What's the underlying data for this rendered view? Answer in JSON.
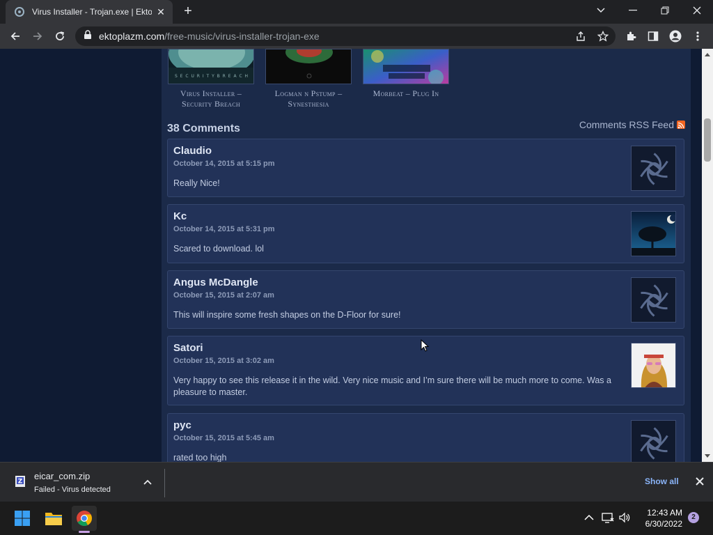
{
  "browser": {
    "tab_title": "Virus Installer - Trojan.exe | Ektoplazm",
    "url_host": "ektoplazm.com",
    "url_path": "/free-music/virus-installer-trojan-exe"
  },
  "related": [
    {
      "caption": "Virus Installer – Security Breach"
    },
    {
      "caption": "Logman n Pstump – Synesthesia"
    },
    {
      "caption": "Morbeat – Plug In"
    }
  ],
  "comments_section": {
    "heading": "38 Comments",
    "rss_label": "Comments RSS Feed"
  },
  "comments": [
    {
      "author": "Claudio",
      "date": "October 14, 2015 at 5:15 pm",
      "text": "Really Nice!",
      "avatar": "default-swirl-avatar"
    },
    {
      "author": "Kc",
      "date": "October 14, 2015 at 5:31 pm",
      "text": "Scared to download. lol",
      "avatar": "tree-night-avatar"
    },
    {
      "author": "Angus McDangle",
      "date": "October 15, 2015 at 2:07 am",
      "text": "This will inspire some fresh shapes on the D-Floor for sure!",
      "avatar": "default-swirl-avatar"
    },
    {
      "author": "Satori",
      "date": "October 15, 2015 at 3:02 am",
      "text": "Very happy to see this release it in the wild. Very nice music and I’m sure there will be much more to come. Was a pleasure to master.",
      "avatar": "photo-avatar"
    },
    {
      "author": "pyc",
      "date": "October 15, 2015 at 5:45 am",
      "text": "rated too high",
      "avatar": "default-swirl-avatar"
    }
  ],
  "download": {
    "filename": "eicar_com.zip",
    "status": "Failed - Virus detected",
    "show_all": "Show all"
  },
  "taskbar": {
    "time": "12:43 AM",
    "date": "6/30/2022",
    "notifications": "2"
  },
  "colors": {
    "page_bg": "#0f1b33",
    "content_bg": "#1b2a49",
    "comment_bg": "#223258",
    "link_blue": "#8ab4f8"
  }
}
